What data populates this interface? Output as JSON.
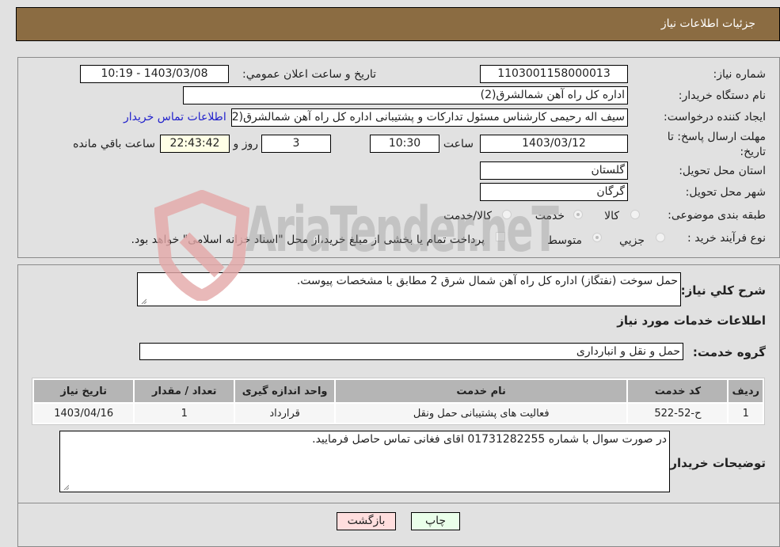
{
  "header": {
    "title": "جزئیات اطلاعات نیاز"
  },
  "info": {
    "need_number_label": "شماره نیاز:",
    "need_number": "1103001158000013",
    "announce_label": "تاریخ و ساعت اعلان عمومي:",
    "announce_value": "1403/03/08 - 10:19",
    "buyer_org_label": "نام دستگاه خریدار:",
    "buyer_org": "اداره کل راه آهن شمالشرق(2)",
    "creator_label": "ایجاد کننده درخواست:",
    "creator": "سیف اله رحیمی کارشناس مسئول تدارکات و پشتیبانی اداره کل راه آهن شمالشرق(2)",
    "contact_link": "اطلاعات تماس خریدار",
    "deadline_label": "مهلت ارسال پاسخ: تا تاریخ:",
    "deadline_date": "1403/03/12",
    "time_label": "ساعت",
    "deadline_time": "10:30",
    "days_value": "3",
    "days_label": "روز و",
    "remaining_time": "22:43:42",
    "remaining_label": "ساعت باقي مانده",
    "province_label": "استان محل تحویل:",
    "province": "گلستان",
    "city_label": "شهر محل تحویل:",
    "city": "گرگان",
    "category_label": "طبقه بندی موضوعی:",
    "category_options": [
      {
        "label": "کالا",
        "checked": false
      },
      {
        "label": "خدمت",
        "checked": true
      },
      {
        "label": "کالا/خدمت",
        "checked": false
      }
    ],
    "process_label": "نوع فرآیند خرید :",
    "process_options": [
      {
        "label": "جزيي",
        "checked": false
      },
      {
        "label": "متوسط",
        "checked": true
      }
    ],
    "treasury_note": "پرداخت تمام یا بخشی از مبلغ خرید،از محل \"اسناد خزانه اسلامی\" خواهد بود."
  },
  "description": {
    "label": "شرح کلي نیاز:",
    "value": "حمل سوخت (نفتگاز) اداره کل راه آهن شمال شرق 2 مطابق با مشخصات پیوست."
  },
  "services": {
    "section_title": "اطلاعات خدمات مورد نیاز",
    "group_label": "گروه خدمت:",
    "group_value": "حمل و نقل و انبارداری",
    "table": {
      "headers": [
        "ردیف",
        "کد خدمت",
        "نام خدمت",
        "واحد اندازه گیری",
        "تعداد / مقدار",
        "تاریخ نیاز"
      ],
      "rows": [
        [
          "1",
          "ح-52-522",
          "فعالیت های پشتیبانی حمل ونقل",
          "قرارداد",
          "1",
          "1403/04/16"
        ]
      ]
    }
  },
  "buyer_notes": {
    "label": "توضیحات خریدار:",
    "value": "در صورت سوال با شماره 01731282255 اقای فغانی تماس حاصل فرمایید."
  },
  "buttons": {
    "print": "چاپ",
    "back": "بازگشت"
  },
  "watermark": {
    "text": "AriaTender.neT"
  }
}
